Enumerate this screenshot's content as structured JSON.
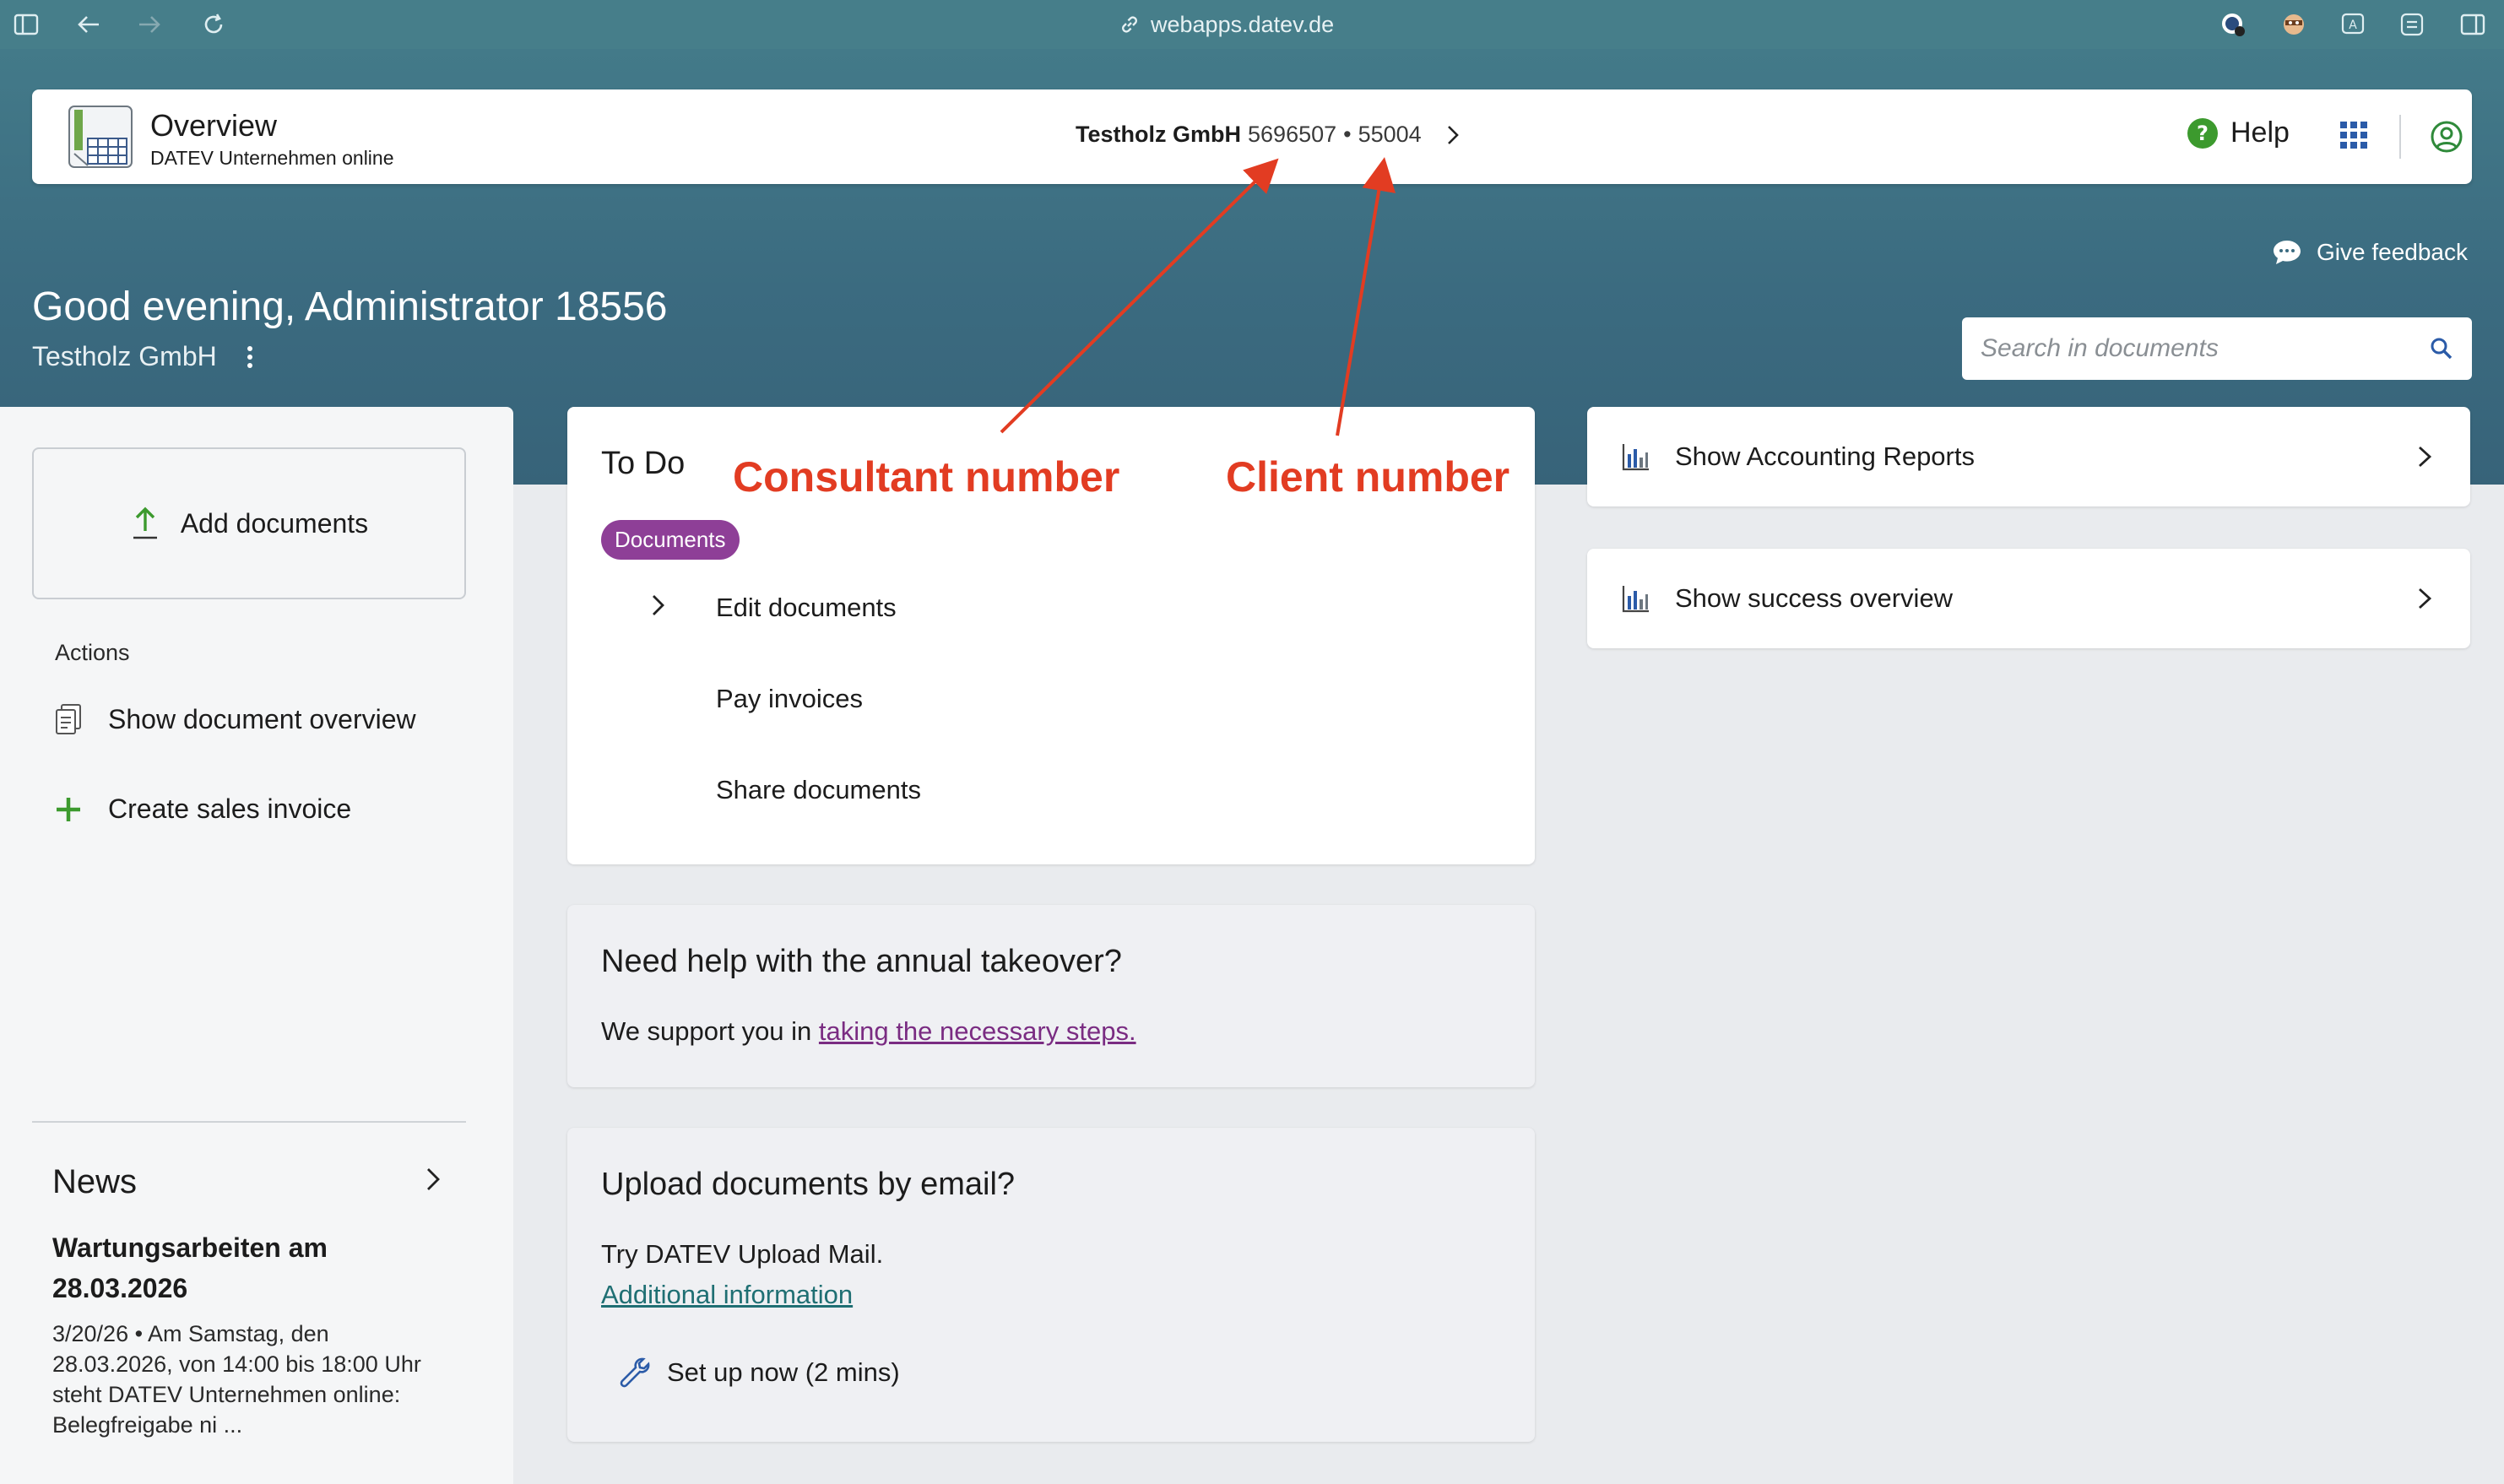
{
  "browser": {
    "url": "webapps.datev.de"
  },
  "appbar": {
    "title": "Overview",
    "subtitle": "DATEV Unternehmen online",
    "client_name": "Testholz GmbH",
    "consultant_number": "5696507",
    "separator": "•",
    "client_number": "55004",
    "help_label": "Help"
  },
  "hero": {
    "feedback_label": "Give feedback",
    "greeting": "Good evening, Administrator 18556",
    "company": "Testholz GmbH",
    "search_placeholder": "Search in documents"
  },
  "left": {
    "add_documents": "Add documents",
    "actions_heading": "Actions",
    "actions": [
      {
        "label": "Show document overview",
        "icon": "document-stack-icon"
      },
      {
        "label": "Create sales invoice",
        "icon": "plus-icon"
      }
    ],
    "news": {
      "heading": "News",
      "title": "Wartungsarbeiten am 28.03.2026",
      "body": "3/20/26 • Am Samstag, den 28.03.2026, von 14:00 bis 18:00 Uhr steht DATEV Unternehmen online: Belegfreigabe ni ..."
    }
  },
  "todo": {
    "heading": "To Do",
    "badge": "Documents",
    "items": [
      "Edit documents",
      "Pay invoices",
      "Share documents"
    ]
  },
  "annual": {
    "heading": "Need help with the annual takeover?",
    "text": "We support you in",
    "link": "taking the necessary steps."
  },
  "email": {
    "heading": "Upload documents by email?",
    "text": "Try DATEV Upload Mail.",
    "link": "Additional information",
    "setup": "Set up now (2 mins)"
  },
  "right": {
    "cards": [
      "Show Accounting Reports",
      "Show success overview"
    ]
  },
  "annotations": {
    "consultant": "Consultant number",
    "client": "Client number",
    "color": "#e23c22"
  },
  "colors": {
    "hero": "#3b6b80",
    "badge": "#8e3f97",
    "help_icon": "#3c9a2e"
  }
}
